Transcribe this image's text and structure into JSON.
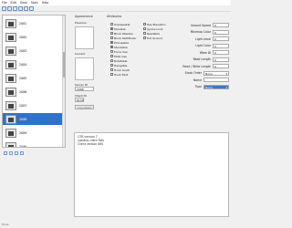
{
  "menu": [
    "File",
    "Edit",
    "View",
    "Tools",
    "Help"
  ],
  "list": {
    "items": [
      {
        "label": "2081",
        "selected": false
      },
      {
        "label": "2082",
        "selected": false
      },
      {
        "label": "2083",
        "selected": false
      },
      {
        "label": "2084",
        "selected": false
      },
      {
        "label": "2085",
        "selected": false
      },
      {
        "label": "2086",
        "selected": false
      },
      {
        "label": "2087",
        "selected": false
      },
      {
        "label": "2088",
        "selected": true
      },
      {
        "label": "2089",
        "selected": false
      },
      {
        "label": "2090",
        "selected": false
      }
    ]
  },
  "appearance": {
    "title": "Appearance",
    "previous_label": "Previous",
    "current_label": "Current",
    "server_id_label": "Server ID",
    "server_id_value": "2088",
    "client_id_label": "Client ID",
    "client_id_value": "8155",
    "disabled_button": "Copy/Paste"
  },
  "attributes": {
    "title": "Attributes",
    "col1": [
      {
        "label": "Unpassable",
        "checked": false
      },
      {
        "label": "Movable",
        "checked": true
      },
      {
        "label": "Block Missiles",
        "checked": false
      },
      {
        "label": "Block Pathfinder",
        "checked": false
      },
      {
        "label": "Pickupable",
        "checked": true
      },
      {
        "label": "Stackable",
        "checked": true
      },
      {
        "label": "Force Use",
        "checked": false
      },
      {
        "label": "Multi Use",
        "checked": false
      },
      {
        "label": "Rotatable",
        "checked": false
      },
      {
        "label": "Hangable",
        "checked": false
      },
      {
        "label": "Hook South",
        "checked": false
      },
      {
        "label": "Hook East",
        "checked": false
      }
    ],
    "col2": [
      {
        "label": "Has Elevation",
        "checked": false
      },
      {
        "label": "Ignore Look",
        "checked": false
      },
      {
        "label": "Readable",
        "checked": false
      },
      {
        "label": "Full Ground",
        "checked": false
      }
    ],
    "fields": [
      {
        "label": "Ground Speed",
        "value": "0"
      },
      {
        "label": "Minimap Color",
        "value": "0"
      },
      {
        "label": "Light Level",
        "value": "0"
      },
      {
        "label": "Light Color",
        "value": "0"
      },
      {
        "label": "Ware ID",
        "value": "0"
      },
      {
        "label": "Read Length",
        "value": "0"
      },
      {
        "label": "Read / Write Length",
        "value": "0"
      }
    ],
    "stack_order_label": "Stack Order",
    "stack_order_value": "None",
    "name_label": "Name",
    "name_value": "",
    "type_label": "Type",
    "type_value": "None"
  },
  "console": {
    "lines": [
      "OTB version 7",
      "Loading client files",
      "Client version 860"
    ]
  },
  "status": "Done."
}
